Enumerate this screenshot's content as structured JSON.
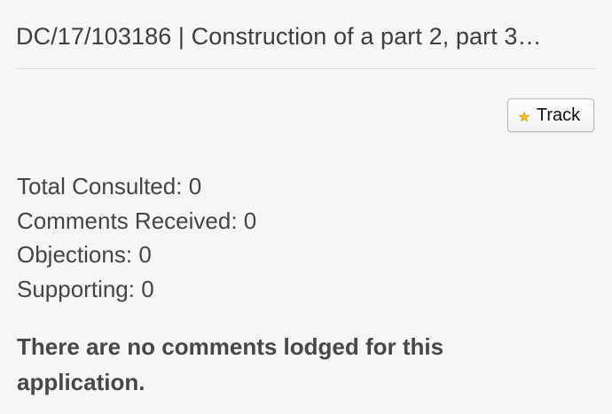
{
  "header": {
    "title": "DC/17/103186 | Construction of a part 2, part 3…"
  },
  "actions": {
    "track_label": "Track",
    "track_icon": "star-icon"
  },
  "stats": [
    {
      "label": "Total Consulted:",
      "value": "0"
    },
    {
      "label": "Comments Received:",
      "value": "0"
    },
    {
      "label": "Objections:",
      "value": "0"
    },
    {
      "label": "Supporting:",
      "value": "0"
    }
  ],
  "message": {
    "text": "There are no comments lodged for this application."
  },
  "colors": {
    "background": "#f6f6f6",
    "text": "#3a3a3a",
    "divider": "#e0e0e0",
    "star": "#f2c230"
  }
}
